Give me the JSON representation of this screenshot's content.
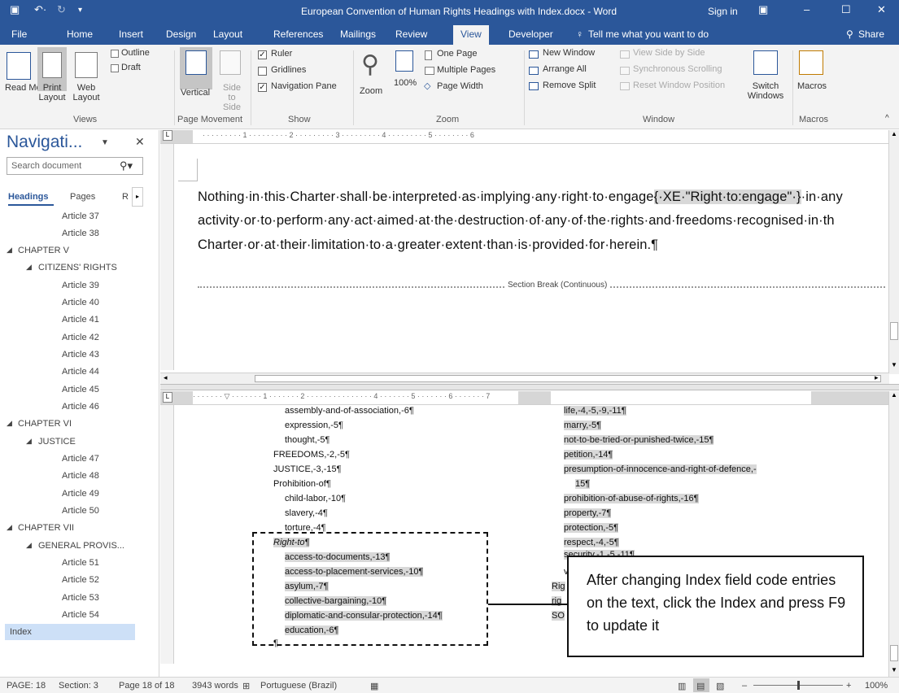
{
  "window": {
    "title": "European Convention of Human Rights Headings with Index.docx  -  Word",
    "sign_in": "Sign in"
  },
  "tabs": [
    "File",
    "Home",
    "Insert",
    "Design",
    "Layout",
    "References",
    "Mailings",
    "Review",
    "View",
    "Developer"
  ],
  "tell_me": "Tell me what you want to do",
  "share": "Share",
  "ribbon": {
    "views": {
      "read_mode": "Read Mode",
      "print_layout": "Print Layout",
      "web_layout": "Web Layout",
      "outline": "Outline",
      "draft": "Draft",
      "group": "Views"
    },
    "page_movement": {
      "vertical": "Vertical",
      "side_to_side": "Side to Side",
      "group": "Page Movement"
    },
    "show": {
      "ruler": "Ruler",
      "gridlines": "Gridlines",
      "navigation_pane": "Navigation Pane",
      "group": "Show"
    },
    "zoom": {
      "zoom": "Zoom",
      "hundred": "100%",
      "one_page": "One Page",
      "multiple_pages": "Multiple Pages",
      "page_width": "Page Width",
      "group": "Zoom"
    },
    "window": {
      "new_window": "New Window",
      "arrange_all": "Arrange All",
      "remove_split": "Remove Split",
      "view_side_by_side": "View Side by Side",
      "sync_scroll": "Synchronous Scrolling",
      "reset_window": "Reset Window Position",
      "switch_windows": "Switch Windows",
      "group": "Window"
    },
    "macros": {
      "macros": "Macros",
      "group": "Macros"
    }
  },
  "nav": {
    "title": "Navigati...",
    "search_placeholder": "Search document",
    "tabs": {
      "headings": "Headings",
      "pages": "Pages",
      "results": "R"
    },
    "items": [
      "Article 37",
      "Article 38",
      "CHAPTER V",
      "CITIZENS' RIGHTS",
      "Article 39",
      "Article 40",
      "Article 41",
      "Article 42",
      "Article 43",
      "Article 44",
      "Article 45",
      "Article 46",
      "CHAPTER VI",
      "JUSTICE",
      "Article 47",
      "Article 48",
      "Article 49",
      "Article 50",
      "CHAPTER VII",
      "GENERAL PROVIS...",
      "Article 51",
      "Article 52",
      "Article 53",
      "Article 54",
      "Index"
    ]
  },
  "doc": {
    "line1_a": "Nothing·in·this·Charter·shall·be·interpreted·as·implying·any·right·to·engage",
    "field_code": "{·XE·\"Right·to:engage\"·}",
    "line1_b": "·in·any",
    "line2": "activity·or·to·perform·any·act·aimed·at·the·destruction·of·any·of·the·rights·and·freedoms·recognised·in·th",
    "line3": "Charter·or·at·their·limitation·to·a·greater·extent·than·is·provided·for·herein.¶",
    "section_break": "Section Break (Continuous)"
  },
  "index": {
    "left": [
      "assembly-and-of-association,-6¶",
      "expression,-5¶",
      "thought,-5¶",
      "FREEDOMS,-2,-5¶",
      "JUSTICE,-3,-15¶",
      "Prohibition-of¶",
      "child-labor,-10¶",
      "slavery,-4¶",
      "torture,-4¶",
      "Right-to¶",
      "access-to-documents,-13¶",
      "access-to-placement-services,-10¶",
      "asylum,-7¶",
      "collective-bargaining,-10¶",
      "diplomatic-and-consular-protection,-14¶",
      "education,-6¶",
      "¶"
    ],
    "right": [
      "life,-4,-5,-9,-11¶",
      "marry,-5¶",
      "not-to-be-tried-or-punished-twice,-15¶",
      "petition,-14¶",
      "presumption-of-innocence-and-right-of-defence,-",
      "15¶",
      "prohibition-of-abuse-of-rights,-16¶",
      "property,-7¶",
      "protection,-5¶",
      "respect,-4,-5¶",
      "security,-1,-5,-11¶",
      "v",
      "Rig",
      "rig",
      "SO"
    ]
  },
  "callout": "After changing Index field code entries on the text, click the Index and press F9 to update it",
  "status": {
    "page": "PAGE: 18",
    "section": "Section: 3",
    "page_of": "Page 18 of 18",
    "words": "3943 words",
    "language": "Portuguese (Brazil)",
    "zoom": "100%"
  }
}
